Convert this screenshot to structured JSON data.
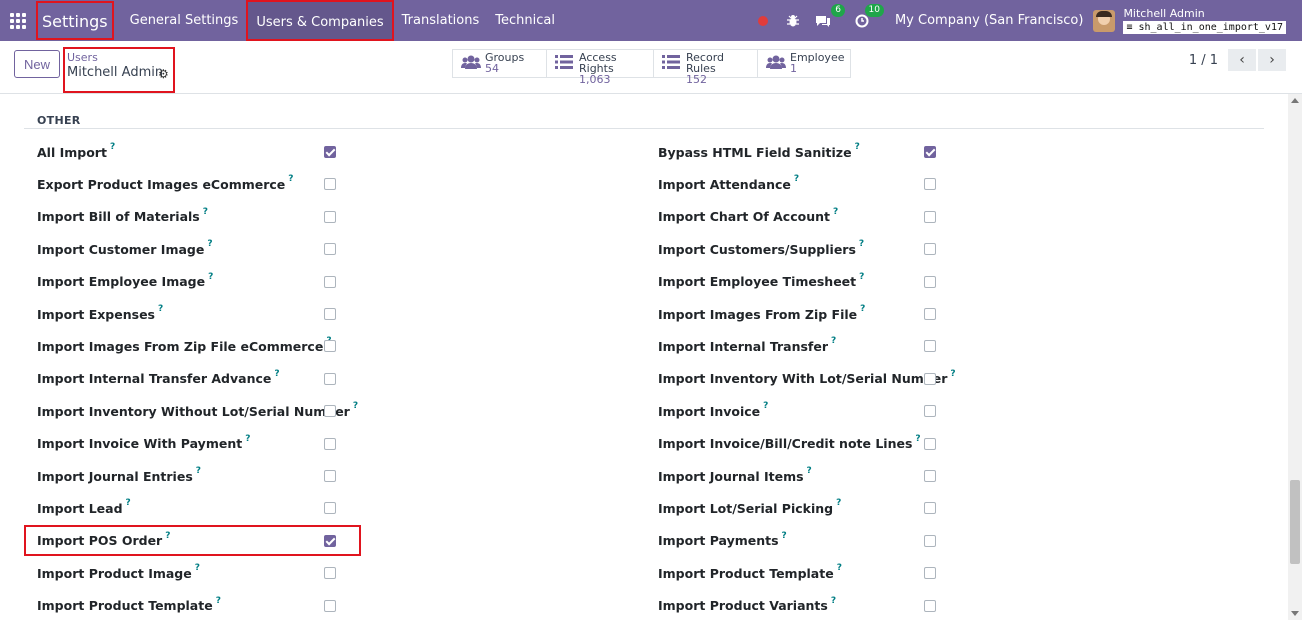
{
  "navbar": {
    "app_title": "Settings",
    "menus": [
      "General Settings",
      "Users & Companies",
      "Translations",
      "Technical"
    ],
    "chat_count": "6",
    "activity_count": "10",
    "company": "My Company (San Francisco)",
    "user_name": "Mitchell Admin",
    "db_name": "sh_all_in_one_import_v17"
  },
  "control": {
    "new_label": "New",
    "breadcrumb_parent": "Users",
    "breadcrumb_current": "Mitchell Admin",
    "stats": [
      {
        "label": "Groups",
        "value": "54",
        "icon": "users-icon"
      },
      {
        "label": "Access Rights",
        "value": "1,063",
        "icon": "list-icon"
      },
      {
        "label": "Record Rules",
        "value": "152",
        "icon": "list-icon"
      },
      {
        "label": "Employee",
        "value": "1",
        "icon": "users-icon"
      }
    ],
    "pager": "1 / 1"
  },
  "section": {
    "title": "OTHER",
    "left": [
      {
        "label": "All Import",
        "checked": true
      },
      {
        "label": "Export Product Images eCommerce",
        "checked": false
      },
      {
        "label": "Import Bill of Materials",
        "checked": false
      },
      {
        "label": "Import Customer Image",
        "checked": false
      },
      {
        "label": "Import Employee Image",
        "checked": false
      },
      {
        "label": "Import Expenses",
        "checked": false
      },
      {
        "label": "Import Images From Zip File eCommerce",
        "checked": false
      },
      {
        "label": "Import Internal Transfer Advance",
        "checked": false
      },
      {
        "label": "Import Inventory Without Lot/Serial Number",
        "checked": false
      },
      {
        "label": "Import Invoice With Payment",
        "checked": false
      },
      {
        "label": "Import Journal Entries",
        "checked": false
      },
      {
        "label": "Import Lead",
        "checked": false
      },
      {
        "label": "Import POS Order",
        "checked": true
      },
      {
        "label": "Import Product Image",
        "checked": false
      },
      {
        "label": "Import Product Template",
        "checked": false
      }
    ],
    "right": [
      {
        "label": "Bypass HTML Field Sanitize",
        "checked": true
      },
      {
        "label": "Import Attendance",
        "checked": false
      },
      {
        "label": "Import Chart Of Account",
        "checked": false
      },
      {
        "label": "Import Customers/Suppliers",
        "checked": false
      },
      {
        "label": "Import Employee Timesheet",
        "checked": false
      },
      {
        "label": "Import Images From Zip File",
        "checked": false
      },
      {
        "label": "Import Internal Transfer",
        "checked": false
      },
      {
        "label": "Import Inventory With Lot/Serial Number",
        "checked": false
      },
      {
        "label": "Import Invoice",
        "checked": false
      },
      {
        "label": "Import Invoice/Bill/Credit note Lines",
        "checked": false
      },
      {
        "label": "Import Journal Items",
        "checked": false
      },
      {
        "label": "Import Lot/Serial Picking",
        "checked": false
      },
      {
        "label": "Import Payments",
        "checked": false
      },
      {
        "label": "Import Product Template",
        "checked": false
      },
      {
        "label": "Import Product Variants",
        "checked": false
      }
    ],
    "help_mark": "?"
  }
}
